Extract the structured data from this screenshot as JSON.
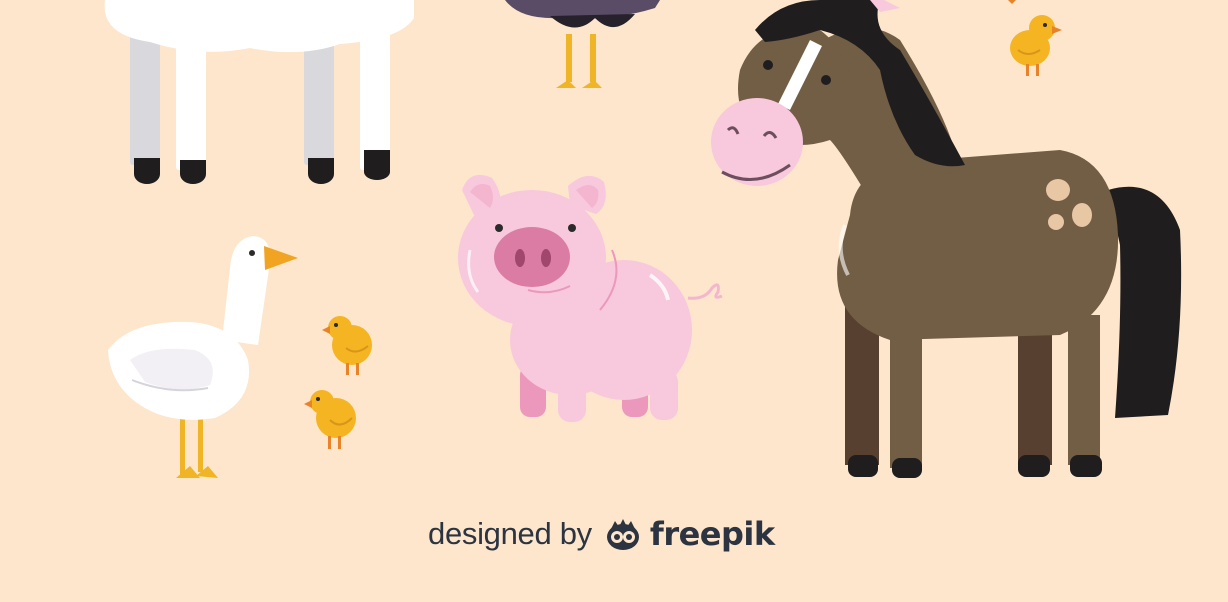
{
  "credit": {
    "designed_by": "designed by",
    "brand": "freepik"
  },
  "animals": [
    "sheep",
    "turkey",
    "horse",
    "pig",
    "goose",
    "chick",
    "chick",
    "chick"
  ],
  "colors": {
    "background": "#fde6cc",
    "pig": "#f8c8dc",
    "horse": "#725d45",
    "mane": "#1f1d1e",
    "chick": "#f5b422",
    "goose": "#ffffff",
    "text": "#2b3440"
  },
  "icons": [
    "freepik-logo-icon"
  ]
}
